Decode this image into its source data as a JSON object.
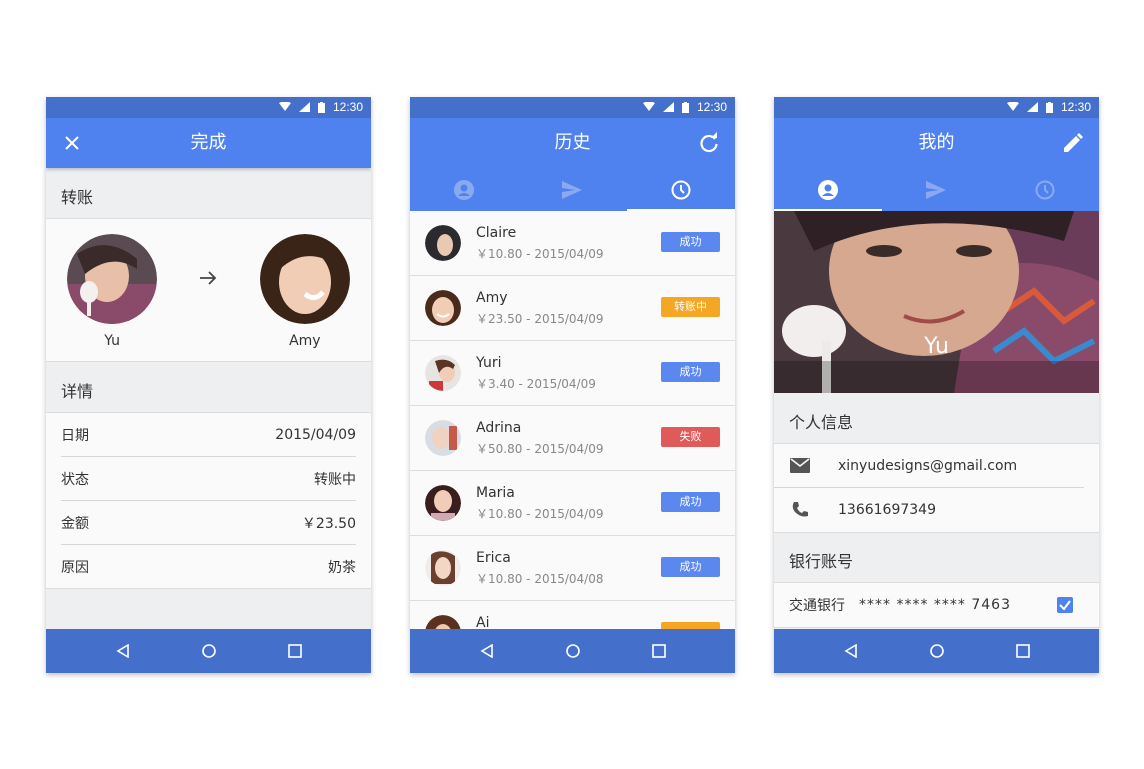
{
  "status": {
    "time": "12:30"
  },
  "screen1": {
    "title": "完成",
    "transfer_section": "转账",
    "from_name": "Yu",
    "to_name": "Amy",
    "details_section": "详情",
    "details": [
      {
        "label": "日期",
        "value": "2015/04/09"
      },
      {
        "label": "状态",
        "value": "转账中"
      },
      {
        "label": "金额",
        "value": "￥23.50"
      },
      {
        "label": "原因",
        "value": "奶茶"
      }
    ]
  },
  "screen2": {
    "title": "历史",
    "items": [
      {
        "name": "Claire",
        "sub": "￥10.80 - 2015/04/09",
        "status": "成功",
        "color": "#5b88ee"
      },
      {
        "name": "Amy",
        "sub": "￥23.50 - 2015/04/09",
        "status": "转账中",
        "color": "#f5a623"
      },
      {
        "name": "Yuri",
        "sub": "￥3.40 - 2015/04/09",
        "status": "成功",
        "color": "#5b88ee"
      },
      {
        "name": "Adrina",
        "sub": "￥50.80 - 2015/04/09",
        "status": "失败",
        "color": "#e05a5a"
      },
      {
        "name": "Maria",
        "sub": "￥10.80 - 2015/04/09",
        "status": "成功",
        "color": "#5b88ee"
      },
      {
        "name": "Erica",
        "sub": "￥10.80 - 2015/04/08",
        "status": "成功",
        "color": "#5b88ee"
      },
      {
        "name": "Ai",
        "sub": "",
        "status": "",
        "color": "#f5a623"
      }
    ]
  },
  "screen3": {
    "title": "我的",
    "hero_name": "Yu",
    "personal_section": "个人信息",
    "email": "xinyudesigns@gmail.com",
    "phone": "13661697349",
    "bank_section": "银行账号",
    "bank_name": "交通银行",
    "bank_number": "**** **** **** 7463"
  },
  "colors": {
    "primary": "#4f82ee",
    "dark": "#4470cc",
    "success": "#5b88ee",
    "pending": "#f5a623",
    "failed": "#e05a5a"
  }
}
